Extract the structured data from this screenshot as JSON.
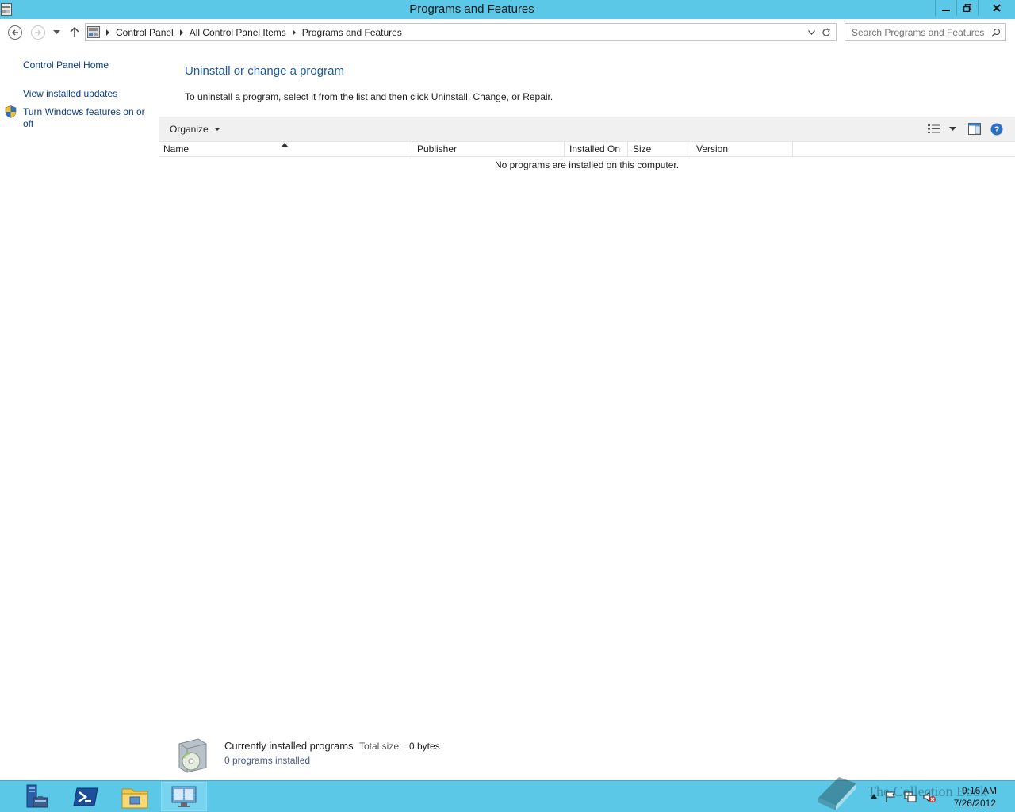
{
  "window": {
    "title": "Programs and Features",
    "controls": {
      "minimize": "minimize",
      "restore": "restore",
      "close": "close"
    }
  },
  "address_bar": {
    "breadcrumbs": [
      "Control Panel",
      "All Control Panel Items",
      "Programs and Features"
    ]
  },
  "search": {
    "placeholder": "Search Programs and Features"
  },
  "left_pane": {
    "home": "Control Panel Home",
    "updates": "View installed updates",
    "features_line1": "Turn Windows features on or",
    "features_line2": "off"
  },
  "main": {
    "heading": "Uninstall or change a program",
    "instructions": "To uninstall a program, select it from the list and then click Uninstall, Change, or Repair.",
    "organize": "Organize",
    "columns": [
      "Name",
      "Publisher",
      "Installed On",
      "Size",
      "Version"
    ],
    "empty_message": "No programs are installed on this computer."
  },
  "details": {
    "title": "Currently installed programs",
    "total_size_label": "Total size:",
    "total_size_value": "0 bytes",
    "count": "0 programs installed"
  },
  "taskbar": {
    "apps": [
      "server-manager-icon",
      "powershell-icon",
      "file-explorer-icon",
      "control-panel-icon"
    ],
    "time": "9:16 AM",
    "date": "7/26/2012"
  },
  "watermark": "The Collection Book",
  "colors": {
    "accent": "#5bc8e8",
    "link": "#0a3d8a",
    "heading": "#1e5aa0"
  }
}
